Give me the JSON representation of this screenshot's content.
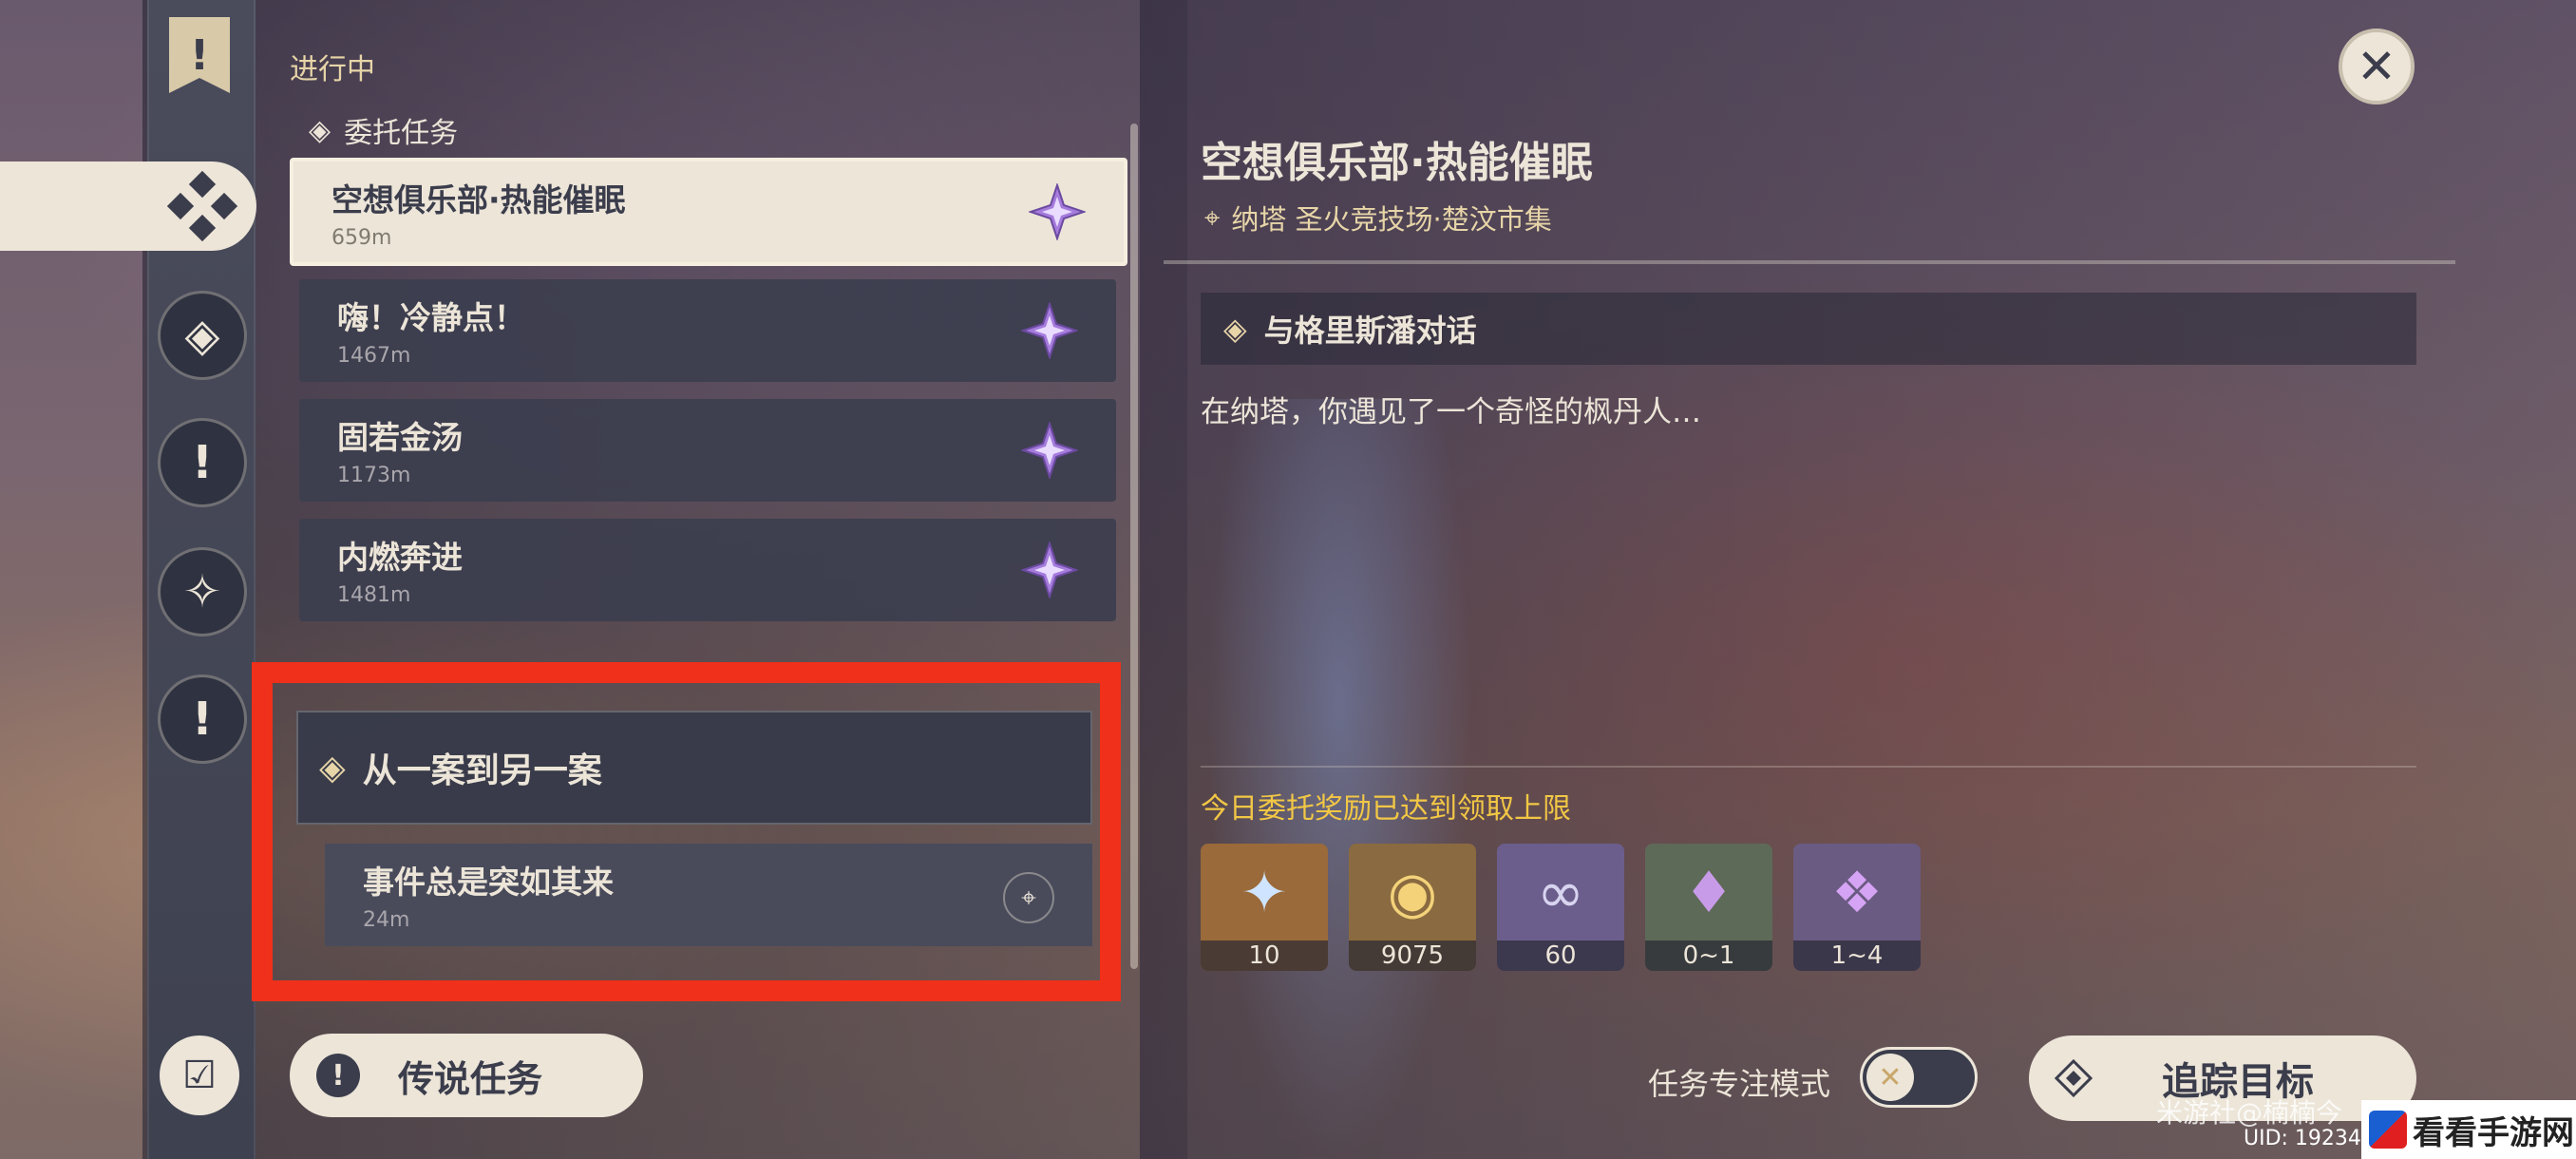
{
  "left_panel": {
    "status_label": "进行中",
    "section_commission": "委托任务",
    "quests": [
      {
        "title": "空想俱乐部·热能催眠",
        "distance": "659m",
        "active": true
      },
      {
        "title": "嗨！冷静点！",
        "distance": "1467m",
        "active": false
      },
      {
        "title": "固若金汤",
        "distance": "1173m",
        "active": false
      },
      {
        "title": "内燃奔进",
        "distance": "1481m",
        "active": false
      }
    ],
    "world_quest": {
      "title": "从一案到另一案",
      "sub_title": "事件总是突如其来",
      "sub_distance": "24m"
    },
    "legend_button": "传说任务"
  },
  "detail": {
    "title": "空想俱乐部·热能催眠",
    "location": "纳塔 圣火竞技场·楚汶市集",
    "objective": "与格里斯潘对话",
    "description": "在纳塔，你遇见了一个奇怪的枫丹人…",
    "reward_note": "今日委托奖励已达到领取上限",
    "rewards": [
      {
        "icon": "adventure-exp-icon",
        "count": "10",
        "color": "#9a6a3a"
      },
      {
        "icon": "mora-icon",
        "count": "9075",
        "color": "#8a6a40"
      },
      {
        "icon": "companionship-exp-icon",
        "count": "60",
        "color": "#6b5e8c"
      },
      {
        "icon": "crystal-small-icon",
        "count": "0~1",
        "color": "#5e6a58"
      },
      {
        "icon": "crystal-large-icon",
        "count": "1~4",
        "color": "#6a5b82"
      }
    ]
  },
  "footer": {
    "focus_mode_label": "任务专注模式",
    "track_button": "追踪目标",
    "watermark_text": "米游社@楠楠今",
    "uid_text": "UID: 19234",
    "site_logo_text": "看看手游网"
  },
  "colors": {
    "accent_gold": "#f2c745",
    "cream": "#ece5d8",
    "dark_slate": "#3b3d4c",
    "highlight_red": "#f0301a",
    "star_purple": "#a57bdc"
  }
}
